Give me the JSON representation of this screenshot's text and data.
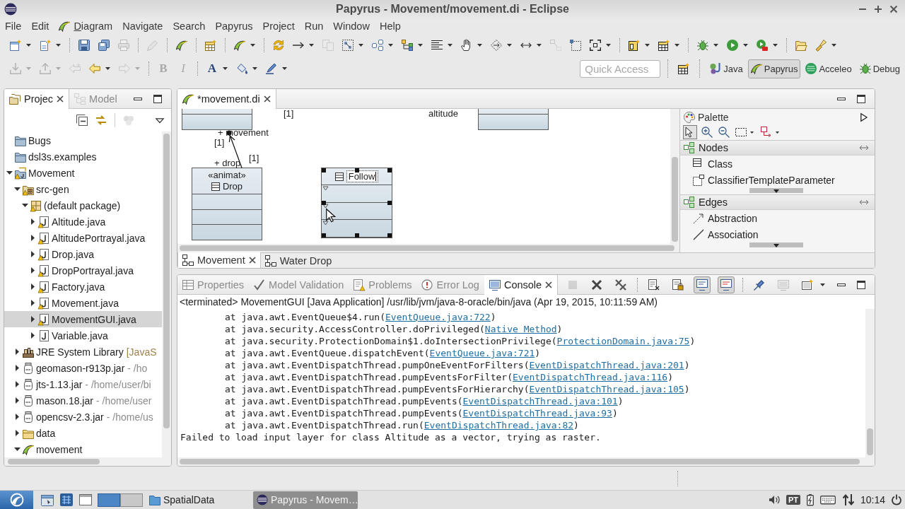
{
  "window": {
    "title": "Papyrus - Movement/movement.di - Eclipse"
  },
  "menu": [
    {
      "label": "File",
      "kind": "plain"
    },
    {
      "label": "Edit",
      "kind": "plain"
    },
    {
      "label": "Diagram",
      "kind": "iconic"
    },
    {
      "label": "Navigate",
      "kind": "plain"
    },
    {
      "label": "Search",
      "kind": "plain"
    },
    {
      "label": "Papyrus",
      "kind": "plain"
    },
    {
      "label": "Project",
      "kind": "plain"
    },
    {
      "label": "Run",
      "kind": "plain"
    },
    {
      "label": "Window",
      "kind": "plain"
    },
    {
      "label": "Help",
      "kind": "plain"
    }
  ],
  "toolbar_1": [
    [
      {
        "disabled": false,
        "dropdown": true
      },
      {
        "disabled": false,
        "dropdown": true
      }
    ],
    [
      {
        "disabled": false,
        "dropdown": false
      },
      {
        "disabled": false,
        "dropdown": false
      },
      {
        "disabled": true,
        "dropdown": false
      }
    ],
    [
      {
        "disabled": true,
        "dropdown": false
      }
    ],
    [
      {
        "disabled": false,
        "dropdown": false
      }
    ],
    [
      {
        "disabled": false,
        "dropdown": false
      }
    ],
    [
      {
        "disabled": false,
        "dropdown": true
      }
    ],
    [
      {
        "disabled": false,
        "dropdown": false
      },
      {
        "disabled": false,
        "dropdown": true
      },
      {
        "disabled": true,
        "dropdown": false
      },
      {
        "disabled": false,
        "dropdown": true
      },
      {
        "disabled": false,
        "dropdown": true
      },
      {
        "disabled": false,
        "dropdown": true
      },
      {
        "disabled": false,
        "dropdown": true
      },
      {
        "disabled": false,
        "dropdown": true
      },
      {
        "disabled": false,
        "dropdown": true
      },
      {
        "disabled": false,
        "dropdown": true
      },
      {
        "disabled": true,
        "dropdown": false
      },
      {
        "disabled": false,
        "dropdown": false
      },
      {
        "disabled": false,
        "dropdown": true
      }
    ],
    [
      {
        "disabled": false,
        "dropdown": true
      },
      {
        "disabled": false,
        "dropdown": true
      }
    ],
    [
      {
        "disabled": false,
        "dropdown": true
      },
      {
        "disabled": false,
        "dropdown": true
      },
      {
        "disabled": false,
        "dropdown": true
      }
    ],
    [
      {
        "disabled": false,
        "dropdown": false
      },
      {
        "disabled": false,
        "dropdown": true
      }
    ]
  ],
  "toolbar_2": [
    [
      {
        "kind": "icon",
        "disabled": true,
        "dropdown": true
      },
      {
        "kind": "icon",
        "disabled": true,
        "dropdown": true
      },
      {
        "kind": "icon",
        "disabled": true,
        "dropdown": false
      },
      {
        "kind": "icon",
        "disabled": false,
        "dropdown": true
      },
      {
        "kind": "icon",
        "disabled": true,
        "dropdown": true
      }
    ],
    [
      {
        "kind": "bold",
        "label": "B",
        "disabled": true,
        "dropdown": false
      },
      {
        "kind": "italic",
        "label": "I",
        "disabled": true,
        "dropdown": false
      }
    ],
    [
      {
        "kind": "font-color",
        "label": "A",
        "disabled": false,
        "dropdown": true
      },
      {
        "kind": "icon",
        "disabled": false,
        "dropdown": true
      },
      {
        "kind": "icon",
        "disabled": false,
        "dropdown": true
      }
    ]
  ],
  "quick_access": {
    "placeholder": "Quick Access"
  },
  "perspectives": [
    {
      "label": "Java",
      "selected": false
    },
    {
      "label": "Papyrus",
      "selected": true
    },
    {
      "label": "Acceleo",
      "selected": false
    },
    {
      "label": "Debug",
      "selected": false
    }
  ],
  "project_view": {
    "tabs": [
      {
        "label": "Projec",
        "selected": true
      },
      {
        "label": "Model",
        "selected": false
      }
    ],
    "toolbar": [
      {
        "disabled": false
      },
      {
        "disabled": false
      },
      {
        "disabled": true
      }
    ],
    "tree": [
      {
        "label": "Bugs",
        "kind": "project",
        "warning": false,
        "selected": false
      },
      {
        "label": "dsl3s.examples",
        "kind": "project",
        "warning": false,
        "selected": false
      },
      {
        "label": "Movement",
        "kind": "java-project",
        "warning": true,
        "selected": false,
        "expanded": true,
        "children": [
          {
            "label": "src-gen",
            "kind": "source-folder",
            "warning": true,
            "selected": false,
            "expanded": true,
            "children": [
              {
                "label": "(default package)",
                "kind": "package",
                "warning": true,
                "selected": false,
                "expanded": true,
                "children": [
                  {
                    "label": "Altitude.java",
                    "kind": "java-file",
                    "warning": true,
                    "selected": false,
                    "expanded": false
                  },
                  {
                    "label": "AltitudePortrayal.java",
                    "kind": "java-file",
                    "warning": true,
                    "selected": false,
                    "expanded": false
                  },
                  {
                    "label": "Drop.java",
                    "kind": "java-file",
                    "warning": true,
                    "selected": false,
                    "expanded": false
                  },
                  {
                    "label": "DropPortrayal.java",
                    "kind": "java-file",
                    "warning": true,
                    "selected": false,
                    "expanded": false
                  },
                  {
                    "label": "Factory.java",
                    "kind": "java-file",
                    "warning": true,
                    "selected": false,
                    "expanded": false
                  },
                  {
                    "label": "Movement.java",
                    "kind": "java-file",
                    "warning": true,
                    "selected": false,
                    "expanded": false
                  },
                  {
                    "label": "MovementGUI.java",
                    "kind": "java-file",
                    "warning": true,
                    "selected": true,
                    "expanded": false
                  },
                  {
                    "label": "Variable.java",
                    "kind": "java-file",
                    "warning": false,
                    "selected": false,
                    "expanded": false
                  }
                ]
              }
            ]
          },
          {
            "label": "JRE System Library",
            "decoration": "[JavaS",
            "kind": "library",
            "warning": false,
            "selected": false,
            "expanded": false
          },
          {
            "label": "geomason-r913p.jar",
            "decoration": "- /ho",
            "kind": "jar",
            "warning": false,
            "selected": false,
            "expanded": false
          },
          {
            "label": "jts-1.13.jar",
            "decoration": "- /home/user/bi",
            "kind": "jar",
            "warning": false,
            "selected": false,
            "expanded": false
          },
          {
            "label": "mason.18.jar",
            "decoration": "- /home/user",
            "kind": "jar",
            "warning": false,
            "selected": false,
            "expanded": false
          },
          {
            "label": "opencsv-2.3.jar",
            "decoration": "- /home/us",
            "kind": "jar",
            "warning": false,
            "selected": false,
            "expanded": false
          },
          {
            "label": "data",
            "kind": "folder",
            "warning": false,
            "selected": false,
            "expanded": false
          },
          {
            "label": "movement",
            "kind": "model",
            "warning": false,
            "selected": false,
            "expanded": true
          }
        ]
      }
    ]
  },
  "editor": {
    "tabs": [
      {
        "label": "*movement.di",
        "selected": true
      }
    ],
    "diagram": {
      "classes": [
        {
          "kind": "cut",
          "selected": false
        },
        {
          "kind": "cut",
          "selected": false
        },
        {
          "kind": "full",
          "stereotype": "«animat»",
          "name": "Drop",
          "selected": false,
          "editing": false
        },
        {
          "kind": "full",
          "name": "Follow",
          "selected": true,
          "editing": true
        }
      ],
      "association": {
        "end_a_role": "+ movement",
        "end_a_multiplicity": "[1]",
        "end_b_multiplicity": "[1]",
        "end_b_role": "+ drop"
      },
      "cut_labels": [
        "[1]",
        "altitude"
      ]
    },
    "palette": {
      "title": "Palette",
      "tools": [
        {
          "selected": true,
          "dropdown": false
        },
        {
          "selected": false,
          "dropdown": false
        },
        {
          "selected": false,
          "dropdown": false
        },
        {
          "selected": false,
          "dropdown": true
        },
        {
          "selected": false,
          "dropdown": true
        }
      ],
      "drawers": [
        {
          "label": "Nodes",
          "expanded": true,
          "items": [
            "Class",
            "ClassifierTemplateParameter"
          ]
        },
        {
          "label": "Edges",
          "expanded": true,
          "items": [
            "Abstraction",
            "Association"
          ]
        }
      ]
    },
    "page_tabs": [
      {
        "label": "Movement",
        "selected": true
      },
      {
        "label": "Water Drop",
        "selected": false
      }
    ]
  },
  "console_view": {
    "tabs": [
      {
        "label": "Properties",
        "selected": false
      },
      {
        "label": "Model Validation",
        "selected": false
      },
      {
        "label": "Problems",
        "selected": false
      },
      {
        "label": "Error Log",
        "selected": false
      },
      {
        "label": "Console",
        "selected": true
      }
    ],
    "toolbar": [
      [
        {
          "disabled": true,
          "pressed": false,
          "dropdown": false
        },
        {
          "disabled": false,
          "pressed": false,
          "dropdown": false
        },
        {
          "disabled": false,
          "pressed": false,
          "dropdown": false
        }
      ],
      [
        {
          "disabled": false,
          "pressed": false,
          "dropdown": false
        },
        {
          "disabled": false,
          "pressed": false,
          "dropdown": false
        },
        {
          "disabled": false,
          "pressed": true,
          "dropdown": false
        },
        {
          "disabled": false,
          "pressed": true,
          "dropdown": false
        }
      ],
      [
        {
          "disabled": false,
          "pressed": false,
          "dropdown": false
        },
        {
          "disabled": true,
          "pressed": false,
          "dropdown": false
        },
        {
          "disabled": false,
          "pressed": false,
          "dropdown": true
        }
      ]
    ],
    "header": "<terminated> MovementGUI [Java Application] /usr/lib/jvm/java-8-oracle/bin/java (Apr 19, 2015, 10:11:59 AM)",
    "lines": [
      {
        "kind": "frame",
        "text": "at java.awt.EventQueue$4.run(",
        "link": "EventQueue.java:722",
        "tail": ")"
      },
      {
        "kind": "frame",
        "text": "at java.security.AccessController.doPrivileged(",
        "link": "Native Method",
        "tail": ")"
      },
      {
        "kind": "frame",
        "text": "at java.security.ProtectionDomain$1.doIntersectionPrivilege(",
        "link": "ProtectionDomain.java:75",
        "tail": ")"
      },
      {
        "kind": "frame",
        "text": "at java.awt.EventQueue.dispatchEvent(",
        "link": "EventQueue.java:721",
        "tail": ")"
      },
      {
        "kind": "frame",
        "text": "at java.awt.EventDispatchThread.pumpOneEventForFilters(",
        "link": "EventDispatchThread.java:201",
        "tail": ")"
      },
      {
        "kind": "frame",
        "text": "at java.awt.EventDispatchThread.pumpEventsForFilter(",
        "link": "EventDispatchThread.java:116",
        "tail": ")"
      },
      {
        "kind": "frame",
        "text": "at java.awt.EventDispatchThread.pumpEventsForHierarchy(",
        "link": "EventDispatchThread.java:105",
        "tail": ")"
      },
      {
        "kind": "frame",
        "text": "at java.awt.EventDispatchThread.pumpEvents(",
        "link": "EventDispatchThread.java:101",
        "tail": ")"
      },
      {
        "kind": "frame",
        "text": "at java.awt.EventDispatchThread.pumpEvents(",
        "link": "EventDispatchThread.java:93",
        "tail": ")"
      },
      {
        "kind": "frame",
        "text": "at java.awt.EventDispatchThread.run(",
        "link": "EventDispatchThread.java:82",
        "tail": ")"
      },
      {
        "kind": "message",
        "text": "Failed to load input layer for class Altitude as a vector, trying as raster."
      }
    ]
  },
  "taskbar": {
    "workspaces": [
      {
        "selected": true
      },
      {
        "selected": false
      }
    ],
    "tasks": [
      {
        "label": "SpatialData",
        "selected": false
      },
      {
        "label": "Papyrus - Movem…",
        "selected": true
      }
    ],
    "keyboard_layout": "PT",
    "clock": "10:14"
  }
}
